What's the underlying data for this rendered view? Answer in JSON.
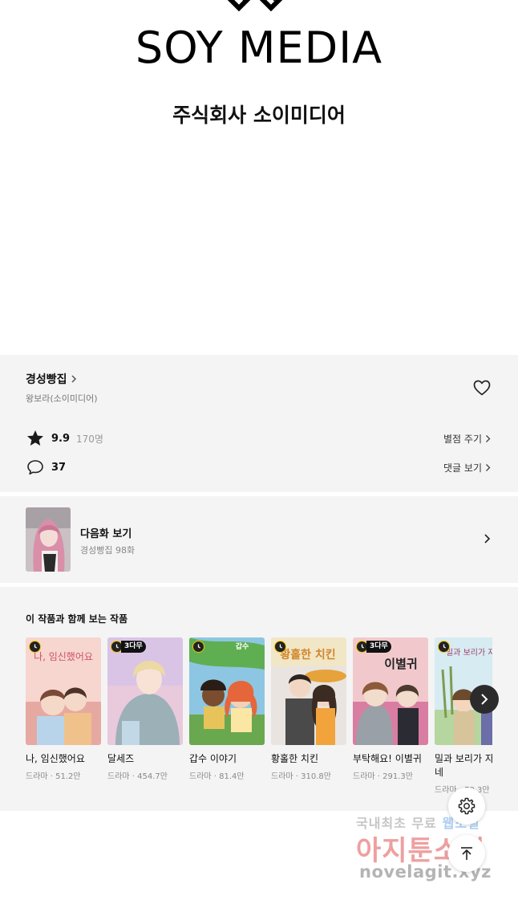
{
  "banner": {
    "logo_text": "SOY MEDIA",
    "company_name": "주식회사 소이미디어"
  },
  "work": {
    "title": "경성빵집",
    "author": "왕보라(소이미디어)",
    "rating": "9.9",
    "rating_count": "170명",
    "rate_link": "별점 주기",
    "comment_count": "37",
    "comment_link": "댓글 보기"
  },
  "next_episode": {
    "label": "다음화 보기",
    "subtitle": "경성빵집 98화"
  },
  "recommend": {
    "heading": "이 작품과 함께 보는 작품",
    "items": [
      {
        "title": "나, 임신했어요",
        "genre": "드라마",
        "views": "51.2만",
        "badge": "",
        "cover_text": "나, 임신했어요"
      },
      {
        "title": "달세즈",
        "genre": "드라마",
        "views": "454.7만",
        "badge": "3다무",
        "cover_text": ""
      },
      {
        "title": "갑수 이야기",
        "genre": "드라마",
        "views": "81.4만",
        "badge": "",
        "cover_text": "갑수"
      },
      {
        "title": "황홀한 치킨",
        "genre": "드라마",
        "views": "310.8만",
        "badge": "",
        "cover_text": "황홀한 치킨"
      },
      {
        "title": "부탁해요! 이별귀",
        "genre": "드라마",
        "views": "291.3만",
        "badge": "3다무",
        "cover_text": "이별귀"
      },
      {
        "title": "밀과 보리가 자라네",
        "genre": "드라마",
        "views": "70.3만",
        "badge": "",
        "cover_text": "밀과 보리가 자라네"
      }
    ]
  },
  "watermark": {
    "line1_a": "국내최초 무료",
    "line1_b": "웹소설",
    "line2": "아지툰소설",
    "line3": "novelagit.xyz"
  },
  "colors": {
    "section_bg": "#f4f4f4",
    "badge_clock_ring": "#f5c400",
    "watermark_red": "#e05454"
  }
}
